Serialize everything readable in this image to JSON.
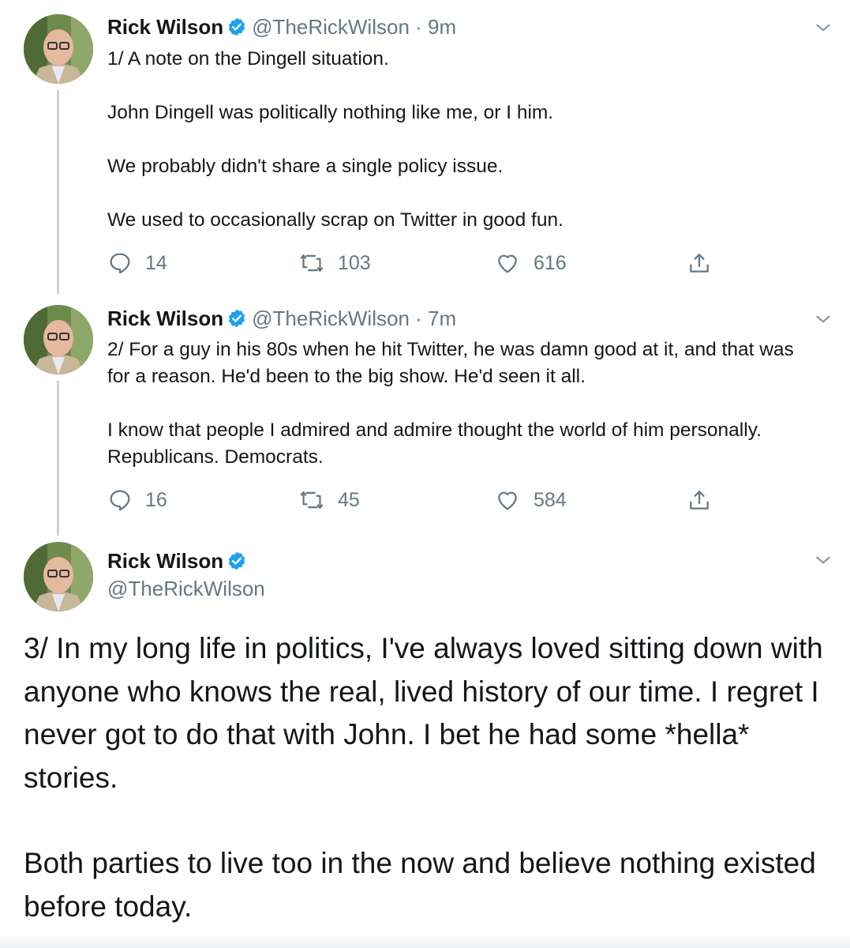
{
  "tweets": [
    {
      "name": "Rick Wilson",
      "handle": "@TheRickWilson",
      "separator": "·",
      "time": "9m",
      "paragraphs": [
        "1/ A note on the Dingell situation.",
        "John Dingell was politically nothing like me, or I him.",
        "We probably didn't share a single policy issue.",
        "We used to occasionally scrap on Twitter in good fun."
      ],
      "replies": "14",
      "retweets": "103",
      "likes": "616"
    },
    {
      "name": "Rick Wilson",
      "handle": "@TheRickWilson",
      "separator": "·",
      "time": "7m",
      "paragraphs": [
        "2/ For a guy in his 80s when he hit Twitter, he was damn good at it, and that was for a reason.  He'd been to the big show. He'd seen it all.",
        "I know that people I admired and admire thought the world of him personally.  Republicans. Democrats."
      ],
      "replies": "16",
      "retweets": "45",
      "likes": "584"
    },
    {
      "name": "Rick Wilson",
      "handle": "@TheRickWilson",
      "paragraphs": [
        "3/ In my long life in politics, I've always loved sitting down with anyone who knows the real, lived history of our time. I regret I never got to do that with John.  I bet he had some *hella* stories.",
        "Both parties to live too in the now and believe nothing existed before today."
      ]
    }
  ],
  "icons": {
    "verified": "verified-badge-icon",
    "reply": "reply-icon",
    "retweet": "retweet-icon",
    "like": "heart-icon",
    "share": "share-icon",
    "more": "chevron-down-icon"
  },
  "colors": {
    "text": "#14171a",
    "muted": "#657786",
    "verified": "#1da1f2",
    "thread_line": "#cdd5dc"
  }
}
